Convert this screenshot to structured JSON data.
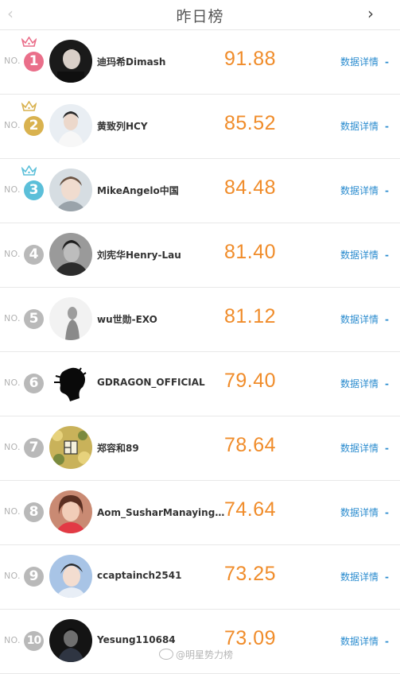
{
  "header": {
    "title": "昨日榜",
    "prev_glyph": "‹",
    "next_glyph": "›"
  },
  "no_label": "NO.",
  "detail_label": "数据详情",
  "detail_arrow": "-",
  "colors": {
    "score": "#f08c2a",
    "link": "#2b8ccf",
    "rank1": "#ea6f8a",
    "rank2": "#d9b24f",
    "rank3": "#5bbfd9",
    "rank_other": "#b9b9b9"
  },
  "entries": [
    {
      "rank": "1",
      "name": "迪玛希Dimash",
      "score": "91.88",
      "crown": "pink"
    },
    {
      "rank": "2",
      "name": "黄致列HCY",
      "score": "85.52",
      "crown": "gold"
    },
    {
      "rank": "3",
      "name": "MikeAngelo中国",
      "score": "84.48",
      "crown": "blue"
    },
    {
      "rank": "4",
      "name": "刘宪华Henry-Lau",
      "score": "81.40"
    },
    {
      "rank": "5",
      "name": "wu世勋-EXO",
      "score": "81.12"
    },
    {
      "rank": "6",
      "name": "GDRAGON_OFFICIAL",
      "score": "79.40"
    },
    {
      "rank": "7",
      "name": "郑容和89",
      "score": "78.64"
    },
    {
      "rank": "8",
      "name": "Aom_SusharManaying_李...",
      "score": "74.64"
    },
    {
      "rank": "9",
      "name": "ccaptainch2541",
      "score": "73.25"
    },
    {
      "rank": "10",
      "name": "Yesung110684",
      "score": "73.09"
    }
  ],
  "watermark": "@明星势力榜"
}
